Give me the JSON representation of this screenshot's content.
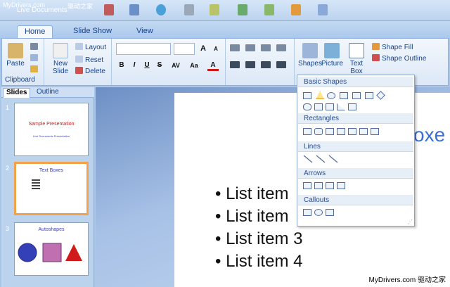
{
  "topbar": {
    "watermark_left": "MyDrivers.com",
    "watermark_right": "驱动之家",
    "app_title": "Live Documents"
  },
  "tabs": [
    {
      "label": "Home",
      "active": true
    },
    {
      "label": "Slide Show",
      "active": false
    },
    {
      "label": "View",
      "active": false
    }
  ],
  "ribbon": {
    "clipboard": {
      "paste_label": "Paste",
      "group_label": "Clipboard"
    },
    "slides": {
      "new_slide_label": "New",
      "new_slide_label2": "Slide",
      "layout_label": "Layout",
      "reset_label": "Reset",
      "delete_label": "Delete"
    },
    "font": {
      "bold": "B",
      "italic": "I",
      "underline": "U",
      "strike": "S",
      "spacing": "AV",
      "case": "Aa",
      "grow": "A",
      "shrink": "A",
      "color": "A"
    },
    "drawing": {
      "shapes_label": "Shapes",
      "picture_label": "Picture",
      "textbox_label": "Text",
      "textbox_label2": "Box",
      "shape_fill_label": "Shape Fill",
      "shape_outline_label": "Shape Outline"
    }
  },
  "panel": {
    "tabs": [
      {
        "label": "Slides",
        "active": true
      },
      {
        "label": "Outline",
        "active": false
      }
    ],
    "slides": [
      {
        "number": "1",
        "title": "Sample Presentation",
        "subtitle": "Live Documents Presentation"
      },
      {
        "number": "2",
        "title": "Text Boxes"
      },
      {
        "number": "3",
        "title": "Autoshapes"
      }
    ]
  },
  "slide": {
    "title_fragment": "oxe",
    "list_items": [
      "List item",
      "List item",
      "List item 3",
      "List item 4"
    ]
  },
  "shapes_menu": {
    "sections": [
      "Basic Shapes",
      "Rectangles",
      "Lines",
      "Arrows",
      "Callouts"
    ]
  },
  "footer": {
    "watermark": "MyDrivers.com  驱动之家"
  },
  "colors": {
    "accent": "#15428b",
    "selected_thumb": "#f3a24a",
    "title_blue": "#3a6fd8",
    "shape_red": "#d11a1a",
    "shape_purple": "#c06fb0",
    "shape_blue": "#3340b8"
  }
}
